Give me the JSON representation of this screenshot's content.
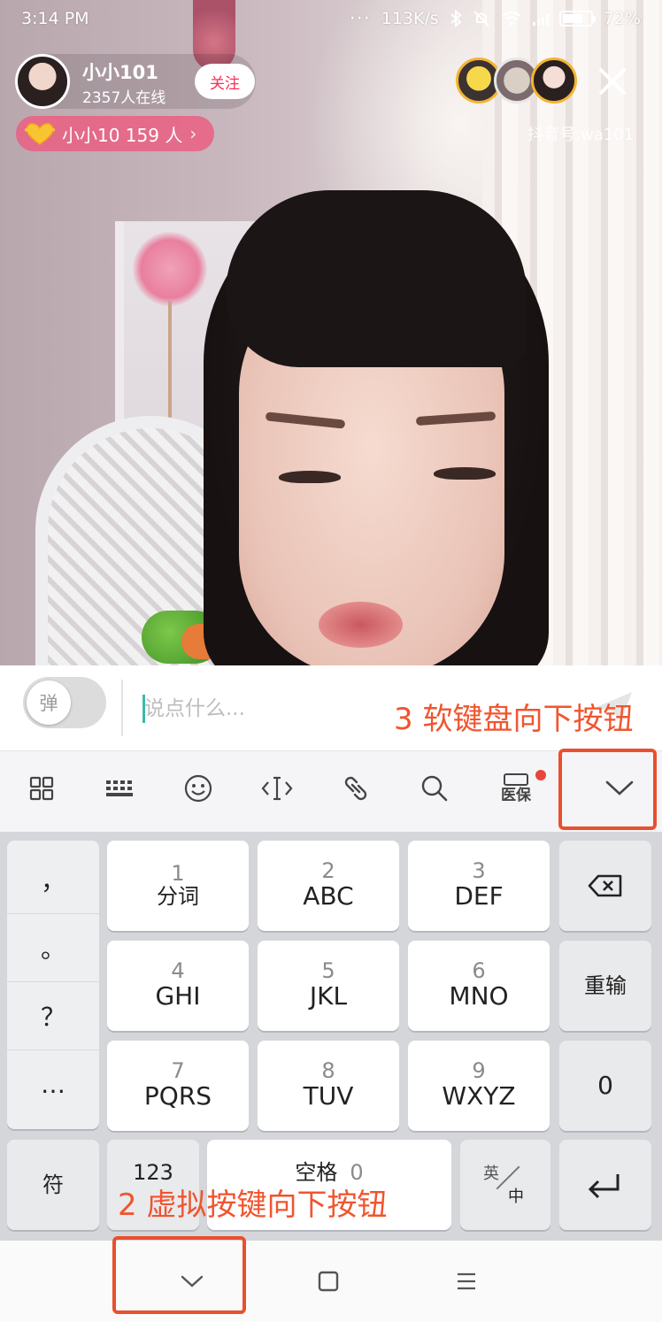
{
  "status_bar": {
    "time": "3:14 PM",
    "network_speed": "113K/s",
    "battery_percent": "72%",
    "battery_level": 0.72
  },
  "live": {
    "host_name": "小小101",
    "online_count": "2357人在线",
    "follow_label": "关注",
    "fans_club": "小小10 159 人",
    "douyin_id": "抖音号:wa101"
  },
  "input_bar": {
    "toggle_label": "弹",
    "placeholder": "说点什么..."
  },
  "toolbar": {
    "icons": [
      "grid-icon",
      "keyboard-icon",
      "emoji-icon",
      "cursor-icon",
      "link-icon",
      "search-icon",
      "medical-insurance-icon",
      "collapse-keyboard-icon"
    ],
    "medical_label": "医保"
  },
  "keyboard": {
    "punctuation": [
      "，",
      "。",
      "？",
      "…"
    ],
    "keys": [
      {
        "num": "1",
        "label": "分词"
      },
      {
        "num": "2",
        "label": "ABC"
      },
      {
        "num": "3",
        "label": "DEF"
      },
      {
        "num": "4",
        "label": "GHI"
      },
      {
        "num": "5",
        "label": "JKL"
      },
      {
        "num": "6",
        "label": "MNO"
      },
      {
        "num": "7",
        "label": "PQRS"
      },
      {
        "num": "8",
        "label": "TUV"
      },
      {
        "num": "9",
        "label": "WXYZ"
      }
    ],
    "reinput_label": "重输",
    "zero_label": "0",
    "symbol_label": "符",
    "num_label": "123",
    "space_label": "空格",
    "space_sub": "0",
    "lang_top": "英",
    "lang_bottom": "中"
  },
  "annotations": {
    "keyboard_down": "3 软键盘向下按钮",
    "nav_down": "2 虚拟按键向下按钮",
    "color": "#e8502e"
  }
}
